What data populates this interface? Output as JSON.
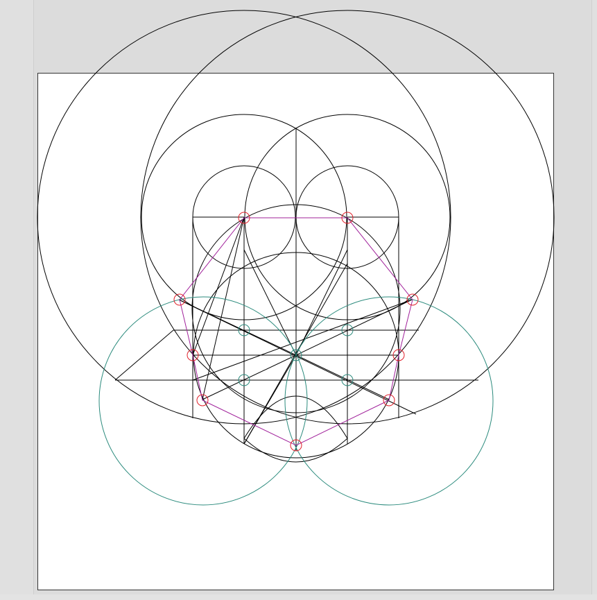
{
  "colors": {
    "workspace": "#dcdcdc",
    "sheet": "#ffffff",
    "construction": "#000000",
    "auxiliary_circles": "#2a8a7c",
    "polygon": "#a0209a",
    "vertex_markers": "#e0202a"
  },
  "construction": {
    "polygon_vertex_count": 9,
    "vertex_marker_count": 9,
    "center_marker_count": 5
  }
}
